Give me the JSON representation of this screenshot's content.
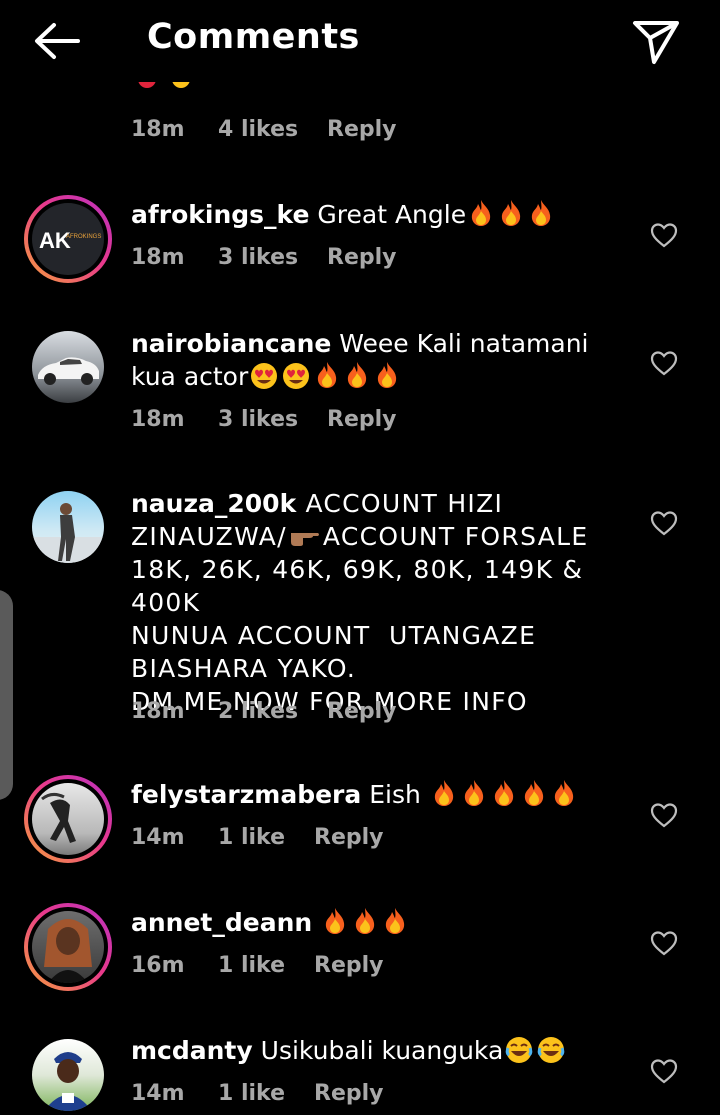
{
  "header": {
    "title": "Comments"
  },
  "top_partial": {
    "time": "18m",
    "likes": "4 likes",
    "reply": "Reply"
  },
  "comments": [
    {
      "username": "afrokings_ke",
      "text": "Great Angle",
      "time": "18m",
      "likes": "3 likes",
      "reply": "Reply",
      "avatar_text": "AK",
      "avatar_subtext": "AFROKINGS"
    },
    {
      "username": "nairobiancane",
      "text": "Weee Kali natamani kua actor",
      "time": "18m",
      "likes": "3 likes",
      "reply": "Reply"
    },
    {
      "username": "nauza_200k",
      "text_lines": [
        "ACCOUNT HIZI",
        "ZINAUZWA/",
        "ACCOUNT FORSALE",
        "18K, 26K, 46K, 69K, 80K, 149K & 400K",
        "NUNUA ACCOUNT  UTANGAZE",
        "BIASHARA YAKO.",
        "DM ME NOW FOR MORE INFO"
      ],
      "time": "18m",
      "likes": "2 likes",
      "reply": "Reply"
    },
    {
      "username": "felystarzmabera",
      "text": "Eish",
      "time": "14m",
      "likes": "1 like",
      "reply": "Reply"
    },
    {
      "username": "annet_deann",
      "text": "",
      "time": "16m",
      "likes": "1 like",
      "reply": "Reply"
    },
    {
      "username": "mcdanty",
      "text": "Usikubali kuanguka",
      "time": "14m",
      "likes": "1 like",
      "reply": "Reply"
    }
  ],
  "icons": {
    "back": "arrow-left-icon",
    "share": "paper-plane-icon",
    "like": "heart-outline-icon",
    "fire": "fire-emoji",
    "heart_eyes": "heart-eyes-emoji",
    "pointing": "pointing-right-emoji",
    "laughing": "tears-of-joy-emoji"
  },
  "colors": {
    "background": "#000000",
    "text": "#ffffff",
    "meta": "#a8a8a8",
    "ring_start": "#f7a23b",
    "ring_end": "#b730c4"
  }
}
